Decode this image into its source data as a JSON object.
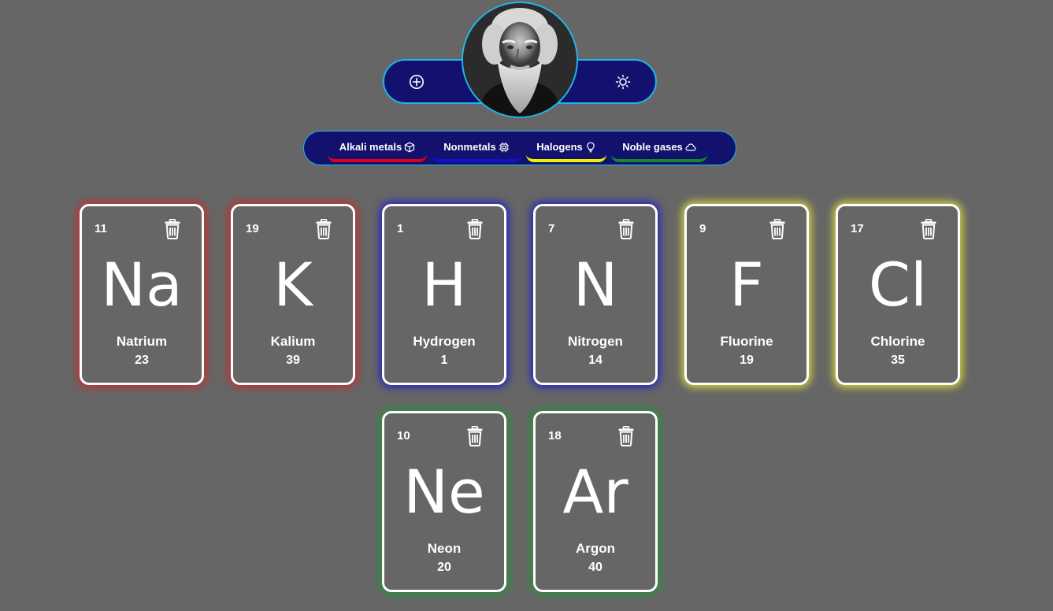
{
  "header": {
    "add_icon": "plus-circle-icon",
    "theme_icon": "sun-icon",
    "avatar_icon": "portrait-photo",
    "accent_color": "#1fb7ec",
    "pill_color": "#12126e"
  },
  "filters": [
    {
      "label": "Alkali metals",
      "icon": "cube-icon",
      "color": "#e0001b"
    },
    {
      "label": "Nonmetals",
      "icon": "chip-icon",
      "color": "#1010d0"
    },
    {
      "label": "Halogens",
      "icon": "lightbulb-icon",
      "color": "#f0f000"
    },
    {
      "label": "Noble gases",
      "icon": "cloud-icon",
      "color": "#118a2a"
    }
  ],
  "elements": [
    {
      "number": "11",
      "symbol": "Na",
      "name": "Natrium",
      "mass": "23",
      "group": "Alkali metals"
    },
    {
      "number": "19",
      "symbol": "K",
      "name": "Kalium",
      "mass": "39",
      "group": "Alkali metals"
    },
    {
      "number": "1",
      "symbol": "H",
      "name": "Hydrogen",
      "mass": "1",
      "group": "Nonmetals"
    },
    {
      "number": "7",
      "symbol": "N",
      "name": "Nitrogen",
      "mass": "14",
      "group": "Nonmetals"
    },
    {
      "number": "9",
      "symbol": "F",
      "name": "Fluorine",
      "mass": "19",
      "group": "Halogens"
    },
    {
      "number": "17",
      "symbol": "Cl",
      "name": "Chlorine",
      "mass": "35",
      "group": "Halogens"
    },
    {
      "number": "10",
      "symbol": "Ne",
      "name": "Neon",
      "mass": "20",
      "group": "Noble gases"
    },
    {
      "number": "18",
      "symbol": "Ar",
      "name": "Argon",
      "mass": "40",
      "group": "Noble gases"
    }
  ]
}
